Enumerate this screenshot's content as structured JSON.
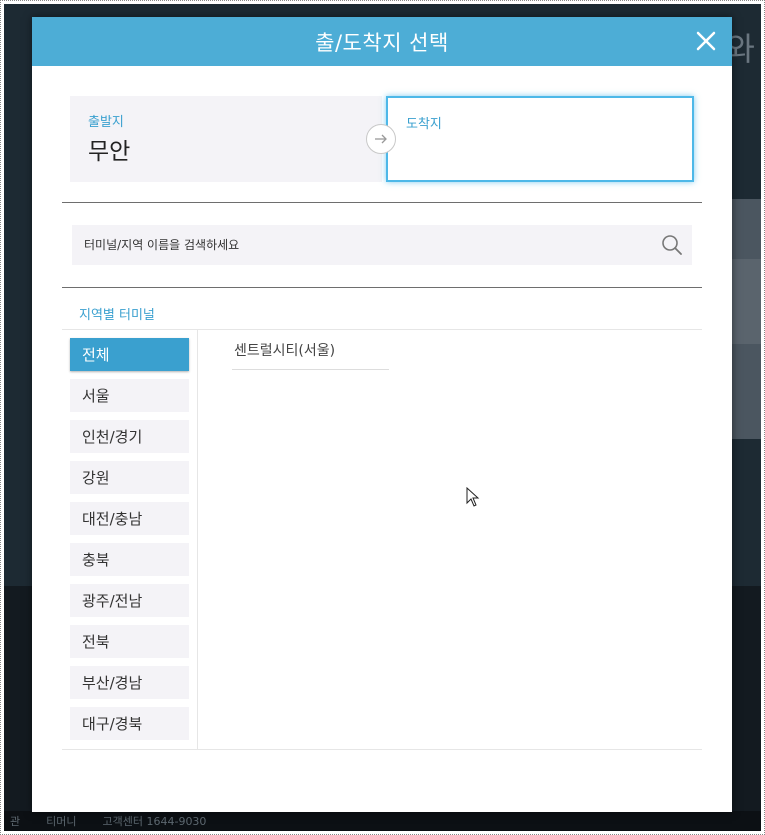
{
  "modal": {
    "title": "출/도착지 선택",
    "close_icon": "close-icon"
  },
  "route": {
    "departure_label": "출발지",
    "departure_value": "무안",
    "arrival_label": "도착지",
    "arrival_value": "",
    "swap_icon": "arrow-right-icon"
  },
  "search": {
    "placeholder": "터미널/지역 이름을 검색하세요",
    "value": "",
    "icon": "search-icon"
  },
  "regions": {
    "title": "지역별 터미널",
    "items": [
      {
        "label": "전체",
        "active": true
      },
      {
        "label": "서울",
        "active": false
      },
      {
        "label": "인천/경기",
        "active": false
      },
      {
        "label": "강원",
        "active": false
      },
      {
        "label": "대전/충남",
        "active": false
      },
      {
        "label": "충북",
        "active": false
      },
      {
        "label": "광주/전남",
        "active": false
      },
      {
        "label": "전북",
        "active": false
      },
      {
        "label": "부산/경남",
        "active": false
      },
      {
        "label": "대구/경북",
        "active": false
      }
    ]
  },
  "terminals": {
    "items": [
      "센트럴시티(서울)"
    ]
  },
  "background": {
    "right_text": "와",
    "footer_items": [
      "관",
      "티머니",
      "고객센터 1644-9030"
    ]
  },
  "colors": {
    "header": "#4dadd6",
    "accent": "#3aa0cf",
    "panel_bg": "#f4f3f7",
    "arrival_border": "#4db8e8"
  }
}
